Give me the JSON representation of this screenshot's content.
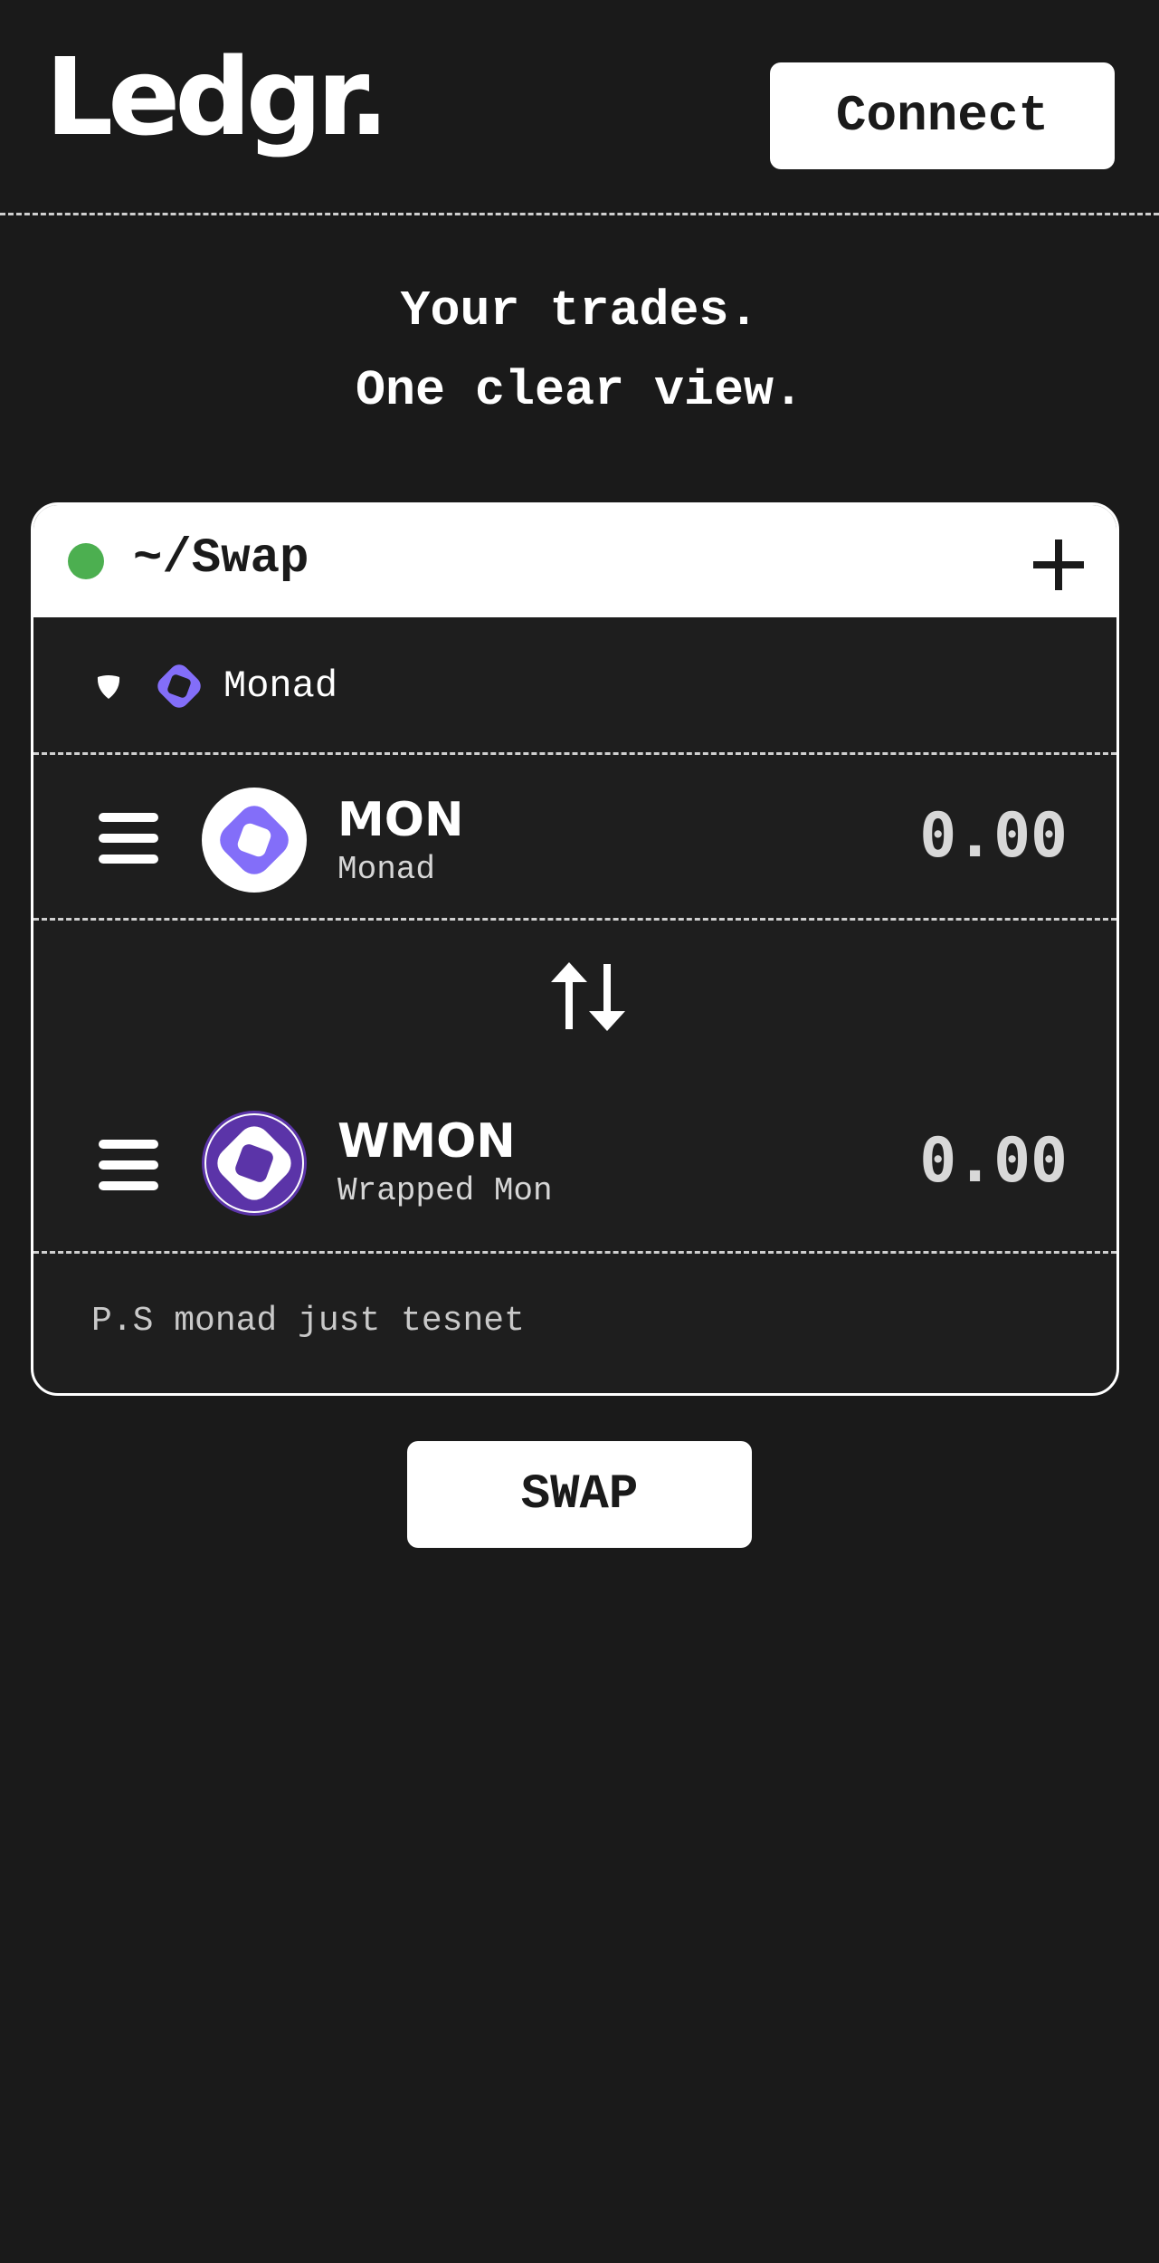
{
  "header": {
    "logo": "Ledgr.",
    "connect_label": "Connect"
  },
  "hero": {
    "line1": "Your trades.",
    "line2": "One clear view."
  },
  "card": {
    "title": "~/Swap",
    "status_color": "#4caf50",
    "network": {
      "label": "Monad",
      "icon": "monad-logo-icon"
    },
    "from_token": {
      "symbol": "MON",
      "name": "Monad",
      "amount": "0.00",
      "icon": "monad-token-icon"
    },
    "to_token": {
      "symbol": "WMON",
      "name": "Wrapped Mon",
      "amount": "0.00",
      "icon": "wrapped-monad-token-icon"
    },
    "note": "P.S monad just tesnet"
  },
  "swap_label": "SWAP",
  "colors": {
    "background": "#1a1a1a",
    "card_background": "#1e1e1e",
    "monad_purple": "#836ef9",
    "wrapped_purple": "#5b34a8",
    "status_green": "#4caf50"
  }
}
